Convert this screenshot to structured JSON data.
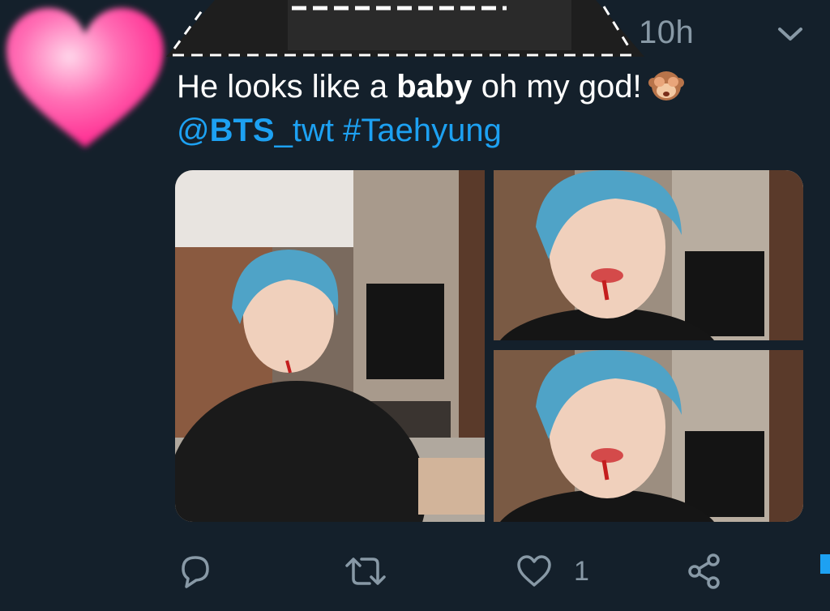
{
  "tweet": {
    "timestamp": "10h",
    "text_before": "He looks like a ",
    "text_bold": "baby",
    "text_after": " oh my god!",
    "emoji": "see-no-evil-monkey",
    "mention_at": "@",
    "mention_bold": "BTS",
    "mention_rest": "_twt",
    "hashtag": "#Taehyung",
    "like_count": "1"
  },
  "colors": {
    "background": "#14202b",
    "link": "#1da1f2",
    "muted": "#8899a6",
    "heart": "#ff3d9a"
  },
  "icons": {
    "reply": "reply-icon",
    "retweet": "retweet-icon",
    "like": "heart-outline-icon",
    "share": "share-icon",
    "more": "chevron-down-icon"
  }
}
